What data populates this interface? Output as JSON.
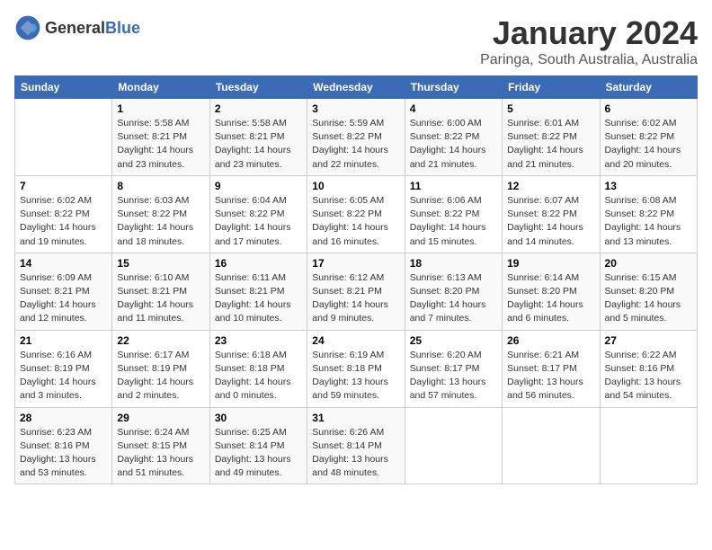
{
  "header": {
    "logo_general": "General",
    "logo_blue": "Blue",
    "month_title": "January 2024",
    "location": "Paringa, South Australia, Australia"
  },
  "days_of_week": [
    "Sunday",
    "Monday",
    "Tuesday",
    "Wednesday",
    "Thursday",
    "Friday",
    "Saturday"
  ],
  "weeks": [
    [
      {
        "day": "",
        "info": ""
      },
      {
        "day": "1",
        "info": "Sunrise: 5:58 AM\nSunset: 8:21 PM\nDaylight: 14 hours\nand 23 minutes."
      },
      {
        "day": "2",
        "info": "Sunrise: 5:58 AM\nSunset: 8:21 PM\nDaylight: 14 hours\nand 23 minutes."
      },
      {
        "day": "3",
        "info": "Sunrise: 5:59 AM\nSunset: 8:22 PM\nDaylight: 14 hours\nand 22 minutes."
      },
      {
        "day": "4",
        "info": "Sunrise: 6:00 AM\nSunset: 8:22 PM\nDaylight: 14 hours\nand 21 minutes."
      },
      {
        "day": "5",
        "info": "Sunrise: 6:01 AM\nSunset: 8:22 PM\nDaylight: 14 hours\nand 21 minutes."
      },
      {
        "day": "6",
        "info": "Sunrise: 6:02 AM\nSunset: 8:22 PM\nDaylight: 14 hours\nand 20 minutes."
      }
    ],
    [
      {
        "day": "7",
        "info": "Sunrise: 6:02 AM\nSunset: 8:22 PM\nDaylight: 14 hours\nand 19 minutes."
      },
      {
        "day": "8",
        "info": "Sunrise: 6:03 AM\nSunset: 8:22 PM\nDaylight: 14 hours\nand 18 minutes."
      },
      {
        "day": "9",
        "info": "Sunrise: 6:04 AM\nSunset: 8:22 PM\nDaylight: 14 hours\nand 17 minutes."
      },
      {
        "day": "10",
        "info": "Sunrise: 6:05 AM\nSunset: 8:22 PM\nDaylight: 14 hours\nand 16 minutes."
      },
      {
        "day": "11",
        "info": "Sunrise: 6:06 AM\nSunset: 8:22 PM\nDaylight: 14 hours\nand 15 minutes."
      },
      {
        "day": "12",
        "info": "Sunrise: 6:07 AM\nSunset: 8:22 PM\nDaylight: 14 hours\nand 14 minutes."
      },
      {
        "day": "13",
        "info": "Sunrise: 6:08 AM\nSunset: 8:22 PM\nDaylight: 14 hours\nand 13 minutes."
      }
    ],
    [
      {
        "day": "14",
        "info": "Sunrise: 6:09 AM\nSunset: 8:21 PM\nDaylight: 14 hours\nand 12 minutes."
      },
      {
        "day": "15",
        "info": "Sunrise: 6:10 AM\nSunset: 8:21 PM\nDaylight: 14 hours\nand 11 minutes."
      },
      {
        "day": "16",
        "info": "Sunrise: 6:11 AM\nSunset: 8:21 PM\nDaylight: 14 hours\nand 10 minutes."
      },
      {
        "day": "17",
        "info": "Sunrise: 6:12 AM\nSunset: 8:21 PM\nDaylight: 14 hours\nand 9 minutes."
      },
      {
        "day": "18",
        "info": "Sunrise: 6:13 AM\nSunset: 8:20 PM\nDaylight: 14 hours\nand 7 minutes."
      },
      {
        "day": "19",
        "info": "Sunrise: 6:14 AM\nSunset: 8:20 PM\nDaylight: 14 hours\nand 6 minutes."
      },
      {
        "day": "20",
        "info": "Sunrise: 6:15 AM\nSunset: 8:20 PM\nDaylight: 14 hours\nand 5 minutes."
      }
    ],
    [
      {
        "day": "21",
        "info": "Sunrise: 6:16 AM\nSunset: 8:19 PM\nDaylight: 14 hours\nand 3 minutes."
      },
      {
        "day": "22",
        "info": "Sunrise: 6:17 AM\nSunset: 8:19 PM\nDaylight: 14 hours\nand 2 minutes."
      },
      {
        "day": "23",
        "info": "Sunrise: 6:18 AM\nSunset: 8:18 PM\nDaylight: 14 hours\nand 0 minutes."
      },
      {
        "day": "24",
        "info": "Sunrise: 6:19 AM\nSunset: 8:18 PM\nDaylight: 13 hours\nand 59 minutes."
      },
      {
        "day": "25",
        "info": "Sunrise: 6:20 AM\nSunset: 8:17 PM\nDaylight: 13 hours\nand 57 minutes."
      },
      {
        "day": "26",
        "info": "Sunrise: 6:21 AM\nSunset: 8:17 PM\nDaylight: 13 hours\nand 56 minutes."
      },
      {
        "day": "27",
        "info": "Sunrise: 6:22 AM\nSunset: 8:16 PM\nDaylight: 13 hours\nand 54 minutes."
      }
    ],
    [
      {
        "day": "28",
        "info": "Sunrise: 6:23 AM\nSunset: 8:16 PM\nDaylight: 13 hours\nand 53 minutes."
      },
      {
        "day": "29",
        "info": "Sunrise: 6:24 AM\nSunset: 8:15 PM\nDaylight: 13 hours\nand 51 minutes."
      },
      {
        "day": "30",
        "info": "Sunrise: 6:25 AM\nSunset: 8:14 PM\nDaylight: 13 hours\nand 49 minutes."
      },
      {
        "day": "31",
        "info": "Sunrise: 6:26 AM\nSunset: 8:14 PM\nDaylight: 13 hours\nand 48 minutes."
      },
      {
        "day": "",
        "info": ""
      },
      {
        "day": "",
        "info": ""
      },
      {
        "day": "",
        "info": ""
      }
    ]
  ]
}
